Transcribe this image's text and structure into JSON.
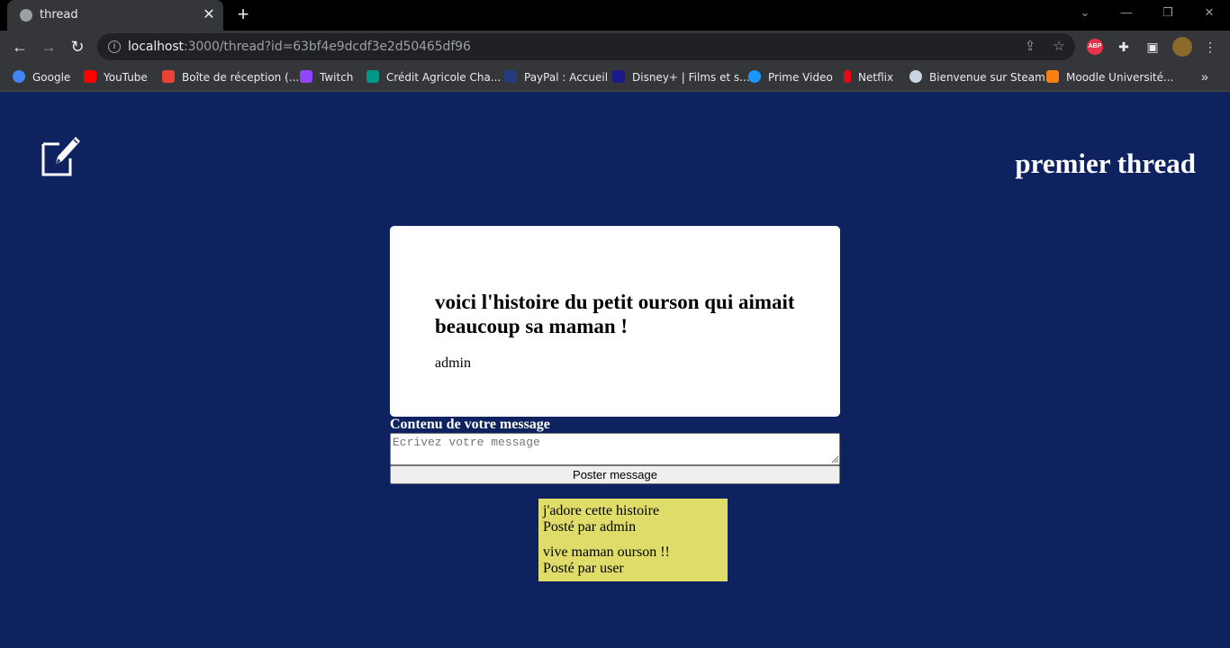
{
  "browser": {
    "tab_title": "thread",
    "url_host": "localhost",
    "url_rest": ":3000/thread?id=63bf4e9dcdf3e2d50465df96",
    "extensions": {
      "abp_label": "ABP"
    },
    "bookmarks": [
      {
        "label": "Google",
        "icon": "google-icon",
        "color": "#4285f4"
      },
      {
        "label": "YouTube",
        "icon": "youtube-icon",
        "color": "#ff0000"
      },
      {
        "label": "Boîte de réception (...",
        "icon": "gmail-icon",
        "color": "#ea4335"
      },
      {
        "label": "Twitch",
        "icon": "twitch-icon",
        "color": "#9146ff"
      },
      {
        "label": "Crédit Agricole Cha...",
        "icon": "credit-agricole-icon",
        "color": "#009688"
      },
      {
        "label": "PayPal : Accueil",
        "icon": "paypal-icon",
        "color": "#253b80"
      },
      {
        "label": "Disney+ | Films et s...",
        "icon": "disney-icon",
        "color": "#1a1a8a"
      },
      {
        "label": "Prime Video",
        "icon": "prime-video-icon",
        "color": "#1a98ff"
      },
      {
        "label": "Netflix",
        "icon": "netflix-icon",
        "color": "#e50914"
      },
      {
        "label": "Bienvenue sur Steam",
        "icon": "steam-icon",
        "color": "#1b2838"
      },
      {
        "label": "Moodle Université...",
        "icon": "moodle-icon",
        "color": "#f98012"
      }
    ]
  },
  "page": {
    "heading": "premier thread",
    "background_color": "#0e2260"
  },
  "post": {
    "title": "voici l'histoire du petit ourson qui aimait beaucoup sa maman !",
    "author": "admin"
  },
  "form": {
    "label": "Contenu de votre message",
    "placeholder": "Ecrivez votre message",
    "submit_label": "Poster message"
  },
  "replies": [
    {
      "text": "j'adore cette histoire",
      "byline": "Posté par admin"
    },
    {
      "text": "vive maman ourson !!",
      "byline": "Posté par user"
    }
  ],
  "colors": {
    "reply_bg": "#dfdc69",
    "card_bg": "#ffffff"
  }
}
